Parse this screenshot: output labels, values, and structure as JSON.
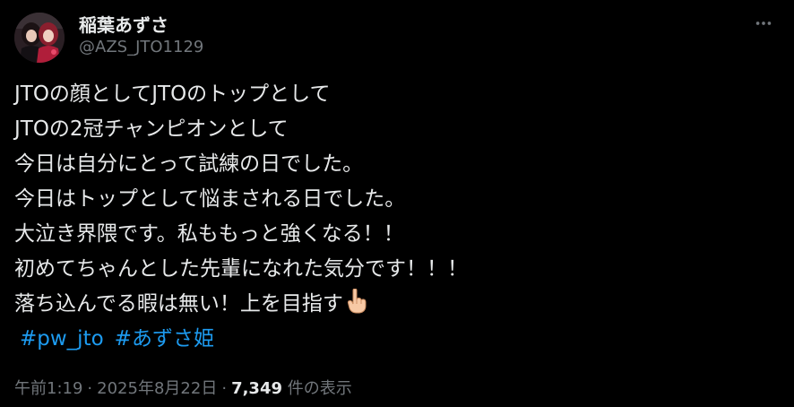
{
  "author": {
    "display_name": "稲葉あずさ",
    "handle": "@AZS_JTO1129"
  },
  "tweet": {
    "lines": [
      "JTOの顔としてJTOのトップとして",
      "JTOの2冠チャンピオンとして",
      "今日は自分にとって試練の日でした。",
      "今日はトップとして悩まされる日でした。",
      "大泣き界隈です。私ももっと強くなる！！",
      "初めてちゃんとした先輩になれた気分です！！！",
      "落ち込んでる暇は無い！上を目指す"
    ],
    "emoji": "pointing-up-hand",
    "hashtags": [
      "#pw_jto",
      "#あずさ姫"
    ]
  },
  "meta": {
    "time": "午前1:19",
    "separator": "·",
    "date": "2025年8月22日",
    "views_count": "7,349",
    "views_label": "件の表示"
  },
  "icons": {
    "more": "more-horizontal-icon"
  },
  "colors": {
    "background": "#000000",
    "text": "#e7e9ea",
    "secondary": "#71767b",
    "link": "#1d9bf0"
  }
}
